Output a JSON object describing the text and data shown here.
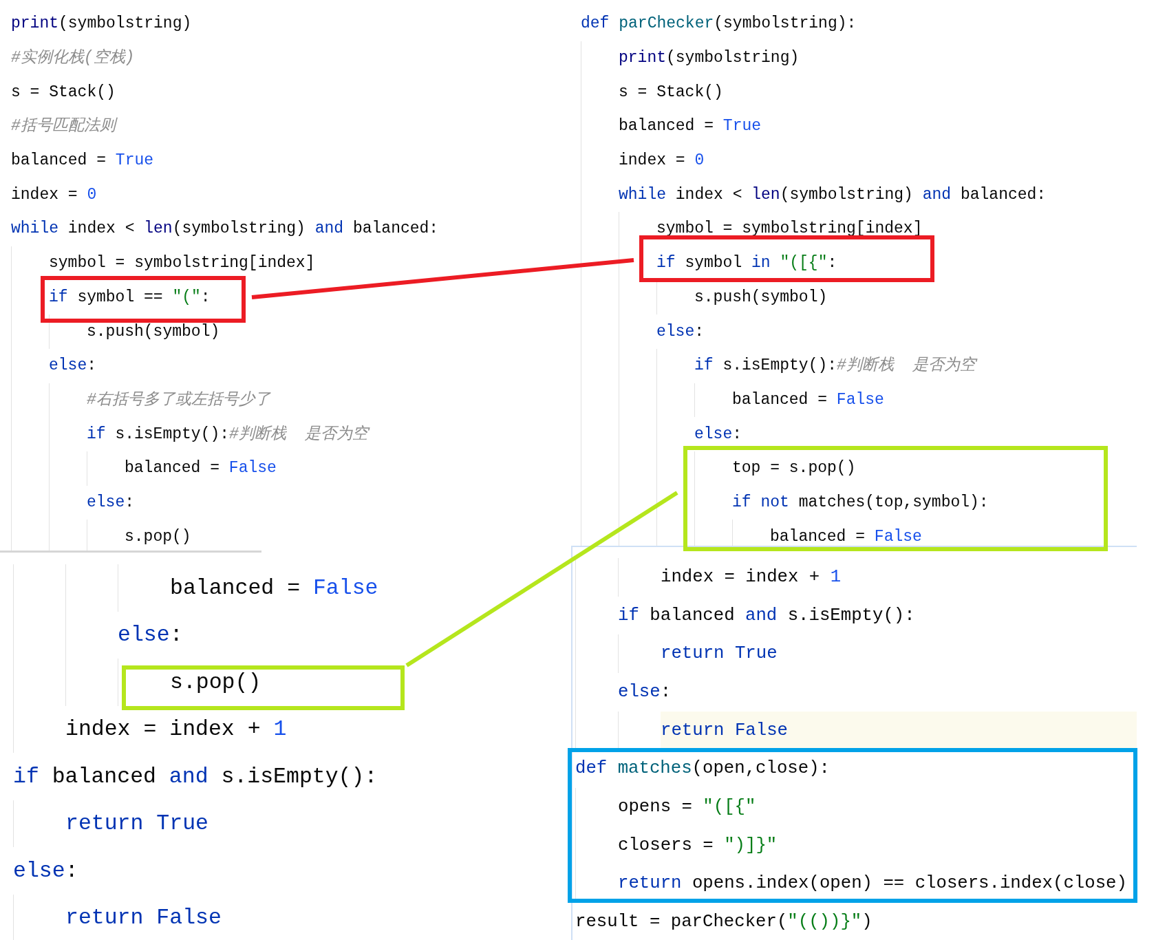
{
  "left_top": {
    "lines": [
      {
        "tokens": [
          {
            "text": "print",
            "kind": "builtin"
          },
          {
            "text": "(symbolstring)",
            "kind": "plain"
          }
        ]
      },
      {
        "tokens": [
          {
            "text": "#实例化栈(空栈)",
            "kind": "comment"
          }
        ]
      },
      {
        "tokens": [
          {
            "text": "s = Stack()",
            "kind": "plain"
          }
        ]
      },
      {
        "tokens": [
          {
            "text": "#括号匹配法则",
            "kind": "comment"
          }
        ]
      },
      {
        "tokens": [
          {
            "text": "balanced = ",
            "kind": "plain"
          },
          {
            "text": "True",
            "kind": "constant"
          }
        ]
      },
      {
        "tokens": [
          {
            "text": "index = ",
            "kind": "plain"
          },
          {
            "text": "0",
            "kind": "number"
          }
        ]
      },
      {
        "tokens": [
          {
            "text": "while",
            "kind": "keyword"
          },
          {
            "text": " index < ",
            "kind": "plain"
          },
          {
            "text": "len",
            "kind": "builtin"
          },
          {
            "text": "(symbolstring) ",
            "kind": "plain"
          },
          {
            "text": "and",
            "kind": "keyword"
          },
          {
            "text": " balanced:",
            "kind": "plain"
          }
        ],
        "children": [
          {
            "tokens": [
              {
                "text": "symbol = symbolstring[index]",
                "kind": "plain"
              }
            ]
          },
          {
            "tokens": [
              {
                "text": "if",
                "kind": "keyword"
              },
              {
                "text": " symbol == ",
                "kind": "plain"
              },
              {
                "text": "\"(\"",
                "kind": "string"
              },
              {
                "text": ":",
                "kind": "plain"
              }
            ],
            "children": [
              {
                "tokens": [
                  {
                    "text": "s.push(symbol)",
                    "kind": "plain"
                  }
                ]
              }
            ]
          },
          {
            "tokens": [
              {
                "text": "else",
                "kind": "keyword"
              },
              {
                "text": ":",
                "kind": "plain"
              }
            ],
            "children": [
              {
                "tokens": [
                  {
                    "text": "#右括号多了或左括号少了",
                    "kind": "comment"
                  }
                ]
              },
              {
                "tokens": [
                  {
                    "text": "if",
                    "kind": "keyword"
                  },
                  {
                    "text": " s.isEmpty():",
                    "kind": "plain"
                  },
                  {
                    "text": "#判断栈  是否为空",
                    "kind": "comment"
                  }
                ],
                "children": [
                  {
                    "tokens": [
                      {
                        "text": "balanced = ",
                        "kind": "plain"
                      },
                      {
                        "text": "False",
                        "kind": "constant"
                      }
                    ]
                  }
                ]
              },
              {
                "tokens": [
                  {
                    "text": "else",
                    "kind": "keyword"
                  },
                  {
                    "text": ":",
                    "kind": "plain"
                  }
                ],
                "children": [
                  {
                    "tokens": [
                      {
                        "text": "s.pop()",
                        "kind": "plain"
                      }
                    ]
                  }
                ]
              }
            ]
          }
        ]
      }
    ]
  },
  "right_top": {
    "lines": [
      {
        "tokens": [
          {
            "text": "def ",
            "kind": "keyword"
          },
          {
            "text": "parChecker",
            "kind": "function"
          },
          {
            "text": "(symbolstring):",
            "kind": "plain"
          }
        ],
        "children": [
          {
            "tokens": [
              {
                "text": "print",
                "kind": "builtin"
              },
              {
                "text": "(symbolstring)",
                "kind": "plain"
              }
            ]
          },
          {
            "tokens": [
              {
                "text": "s = Stack()",
                "kind": "plain"
              }
            ]
          },
          {
            "tokens": [
              {
                "text": "balanced = ",
                "kind": "plain"
              },
              {
                "text": "True",
                "kind": "constant"
              }
            ]
          },
          {
            "tokens": [
              {
                "text": "index = ",
                "kind": "plain"
              },
              {
                "text": "0",
                "kind": "number"
              }
            ]
          },
          {
            "tokens": [
              {
                "text": "while",
                "kind": "keyword"
              },
              {
                "text": " index < ",
                "kind": "plain"
              },
              {
                "text": "len",
                "kind": "builtin"
              },
              {
                "text": "(symbolstring) ",
                "kind": "plain"
              },
              {
                "text": "and",
                "kind": "keyword"
              },
              {
                "text": " balanced:",
                "kind": "plain"
              }
            ],
            "children": [
              {
                "tokens": [
                  {
                    "text": "symbol = symbolstring[index]",
                    "kind": "plain"
                  }
                ]
              },
              {
                "tokens": [
                  {
                    "text": "if",
                    "kind": "keyword"
                  },
                  {
                    "text": " symbol ",
                    "kind": "plain"
                  },
                  {
                    "text": "in ",
                    "kind": "keyword"
                  },
                  {
                    "text": "\"([{\"",
                    "kind": "string"
                  },
                  {
                    "text": ":",
                    "kind": "plain"
                  }
                ],
                "children": [
                  {
                    "tokens": [
                      {
                        "text": "s.push(symbol)",
                        "kind": "plain"
                      }
                    ]
                  }
                ]
              },
              {
                "tokens": [
                  {
                    "text": "else",
                    "kind": "keyword"
                  },
                  {
                    "text": ":",
                    "kind": "plain"
                  }
                ],
                "children": [
                  {
                    "tokens": [
                      {
                        "text": "if",
                        "kind": "keyword"
                      },
                      {
                        "text": " s.isEmpty():",
                        "kind": "plain"
                      },
                      {
                        "text": "#判断栈  是否为空",
                        "kind": "comment"
                      }
                    ],
                    "children": [
                      {
                        "tokens": [
                          {
                            "text": "balanced = ",
                            "kind": "plain"
                          },
                          {
                            "text": "False",
                            "kind": "constant"
                          }
                        ]
                      }
                    ]
                  },
                  {
                    "tokens": [
                      {
                        "text": "else",
                        "kind": "keyword"
                      },
                      {
                        "text": ":",
                        "kind": "plain"
                      }
                    ],
                    "children": [
                      {
                        "tokens": [
                          {
                            "text": "top = s.pop()",
                            "kind": "plain"
                          }
                        ]
                      },
                      {
                        "tokens": [
                          {
                            "text": "if not",
                            "kind": "keyword"
                          },
                          {
                            "text": " matches(top,symbol):",
                            "kind": "plain"
                          }
                        ],
                        "children": [
                          {
                            "tokens": [
                              {
                                "text": "balanced = ",
                                "kind": "plain"
                              },
                              {
                                "text": "False",
                                "kind": "constant"
                              }
                            ]
                          }
                        ]
                      }
                    ]
                  }
                ]
              }
            ]
          }
        ]
      }
    ]
  },
  "left_bottom": {
    "lines": [
      {
        "children": [
          {
            "children": [
              {
                "children": [
                  {
                    "tokens": [
                      {
                        "text": "balanced = ",
                        "kind": "plain"
                      },
                      {
                        "text": "False",
                        "kind": "constant"
                      }
                    ]
                  }
                ]
              },
              {
                "tokens": [
                  {
                    "text": "else",
                    "kind": "keyword"
                  },
                  {
                    "text": ":",
                    "kind": "plain"
                  }
                ],
                "children": [
                  {
                    "tokens": [
                      {
                        "text": "s.pop()",
                        "kind": "plain"
                      }
                    ]
                  }
                ]
              }
            ]
          },
          {
            "tokens": [
              {
                "text": "index = index + ",
                "kind": "plain"
              },
              {
                "text": "1",
                "kind": "number"
              }
            ]
          }
        ]
      },
      {
        "tokens": [
          {
            "text": "if",
            "kind": "keyword"
          },
          {
            "text": " balanced ",
            "kind": "plain"
          },
          {
            "text": "and",
            "kind": "keyword"
          },
          {
            "text": " s.isEmpty():",
            "kind": "plain"
          }
        ],
        "children": [
          {
            "tokens": [
              {
                "text": "return True",
                "kind": "keyword"
              }
            ]
          }
        ]
      },
      {
        "tokens": [
          {
            "text": "else",
            "kind": "keyword"
          },
          {
            "text": ":",
            "kind": "plain"
          }
        ],
        "children": [
          {
            "tokens": [
              {
                "text": "return False",
                "kind": "keyword"
              }
            ]
          }
        ]
      }
    ]
  },
  "right_bottom": {
    "lines": [
      {
        "children": [
          {
            "children": [
              {
                "tokens": [
                  {
                    "text": "index = index + ",
                    "kind": "plain"
                  },
                  {
                    "text": "1",
                    "kind": "number"
                  }
                ]
              }
            ]
          },
          {
            "tokens": [
              {
                "text": "if",
                "kind": "keyword"
              },
              {
                "text": " balanced ",
                "kind": "plain"
              },
              {
                "text": "and",
                "kind": "keyword"
              },
              {
                "text": " s.isEmpty():",
                "kind": "plain"
              }
            ],
            "children": [
              {
                "tokens": [
                  {
                    "text": "return True",
                    "kind": "keyword"
                  }
                ]
              }
            ]
          },
          {
            "tokens": [
              {
                "text": "else",
                "kind": "keyword"
              },
              {
                "text": ":",
                "kind": "plain"
              }
            ],
            "children": [
              {
                "current": true,
                "tokens": [
                  {
                    "text": "return False",
                    "kind": "keyword"
                  }
                ]
              }
            ]
          }
        ]
      },
      {
        "tokens": [
          {
            "text": "def ",
            "kind": "keyword"
          },
          {
            "text": "matches",
            "kind": "function"
          },
          {
            "text": "(open,close):",
            "kind": "plain"
          }
        ],
        "children": [
          {
            "tokens": [
              {
                "text": "opens = ",
                "kind": "plain"
              },
              {
                "text": "\"([{\"",
                "kind": "string"
              }
            ]
          },
          {
            "tokens": [
              {
                "text": "closers = ",
                "kind": "plain"
              },
              {
                "text": "\")]}\"",
                "kind": "string"
              }
            ]
          },
          {
            "tokens": [
              {
                "text": "return",
                "kind": "keyword"
              },
              {
                "text": " opens.index(open) == closers.index(close)",
                "kind": "plain"
              }
            ]
          }
        ]
      },
      {
        "tokens": [
          {
            "text": "result = parChecker(",
            "kind": "plain"
          },
          {
            "text": "\"(())}\"",
            "kind": "string"
          },
          {
            "text": ")",
            "kind": "plain"
          }
        ]
      }
    ]
  },
  "annotations": [
    {
      "kind": "box",
      "color": "#ec1c24"
    },
    {
      "kind": "connector",
      "color": "#ec1c24"
    },
    {
      "kind": "box",
      "color": "#ec1c24"
    },
    {
      "kind": "box",
      "color": "#b5e61d"
    },
    {
      "kind": "connector",
      "color": "#b5e61d"
    },
    {
      "kind": "box",
      "color": "#b5e61d"
    },
    {
      "kind": "box",
      "color": "#00a2e8"
    }
  ]
}
